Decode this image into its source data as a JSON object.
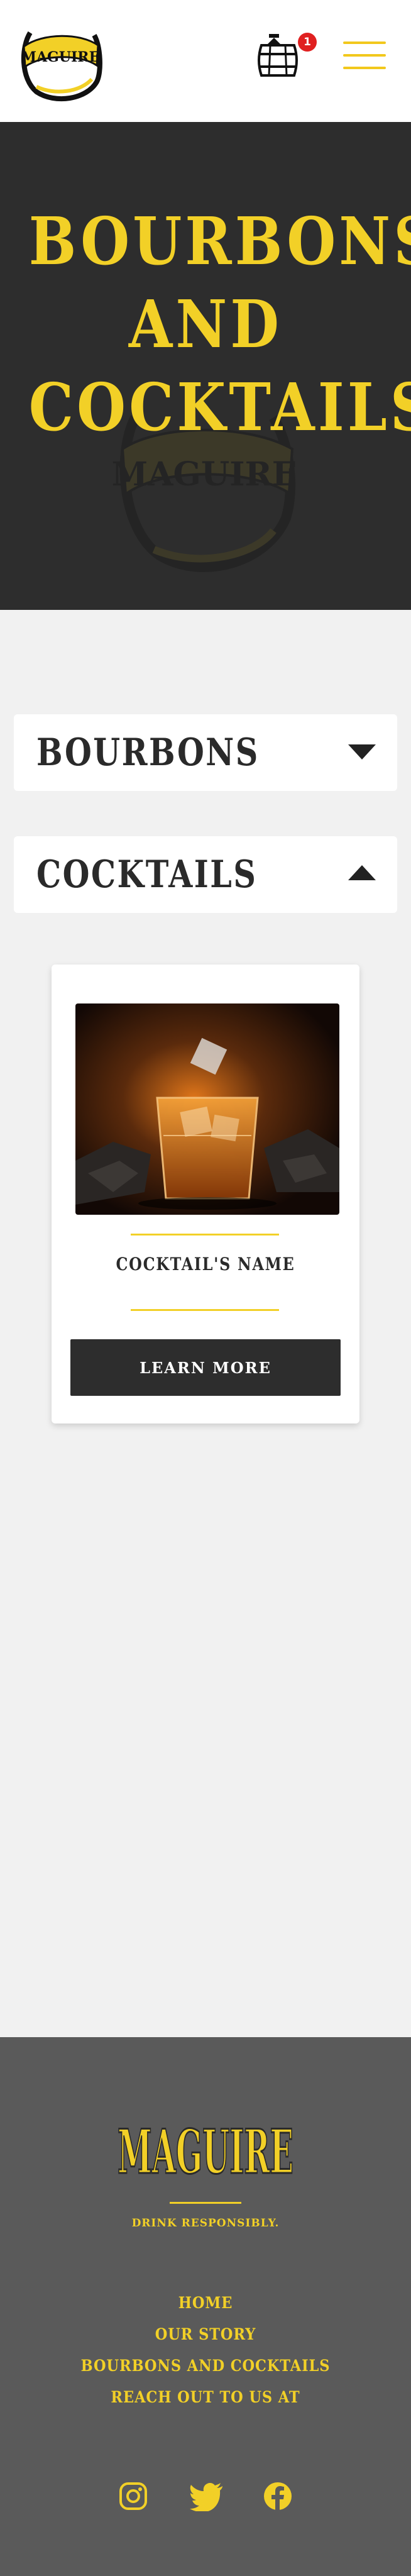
{
  "header": {
    "logo_text": "MAGUIRE",
    "cart_count": "1"
  },
  "hero": {
    "title_line1": "BOURBONS",
    "title_line2": "AND",
    "title_line3": "COCKTAILS",
    "watermark_text": "MAGUIRE"
  },
  "accordion": [
    {
      "label": "BOURBONS",
      "state": "collapsed"
    },
    {
      "label": "COCKTAILS",
      "state": "expanded"
    }
  ],
  "card": {
    "title": "COCKTAIL'S NAME",
    "button_label": "LEARN MORE"
  },
  "footer": {
    "logo_text": "MAGUIRE",
    "tagline": "DRINK RESPONSIBLY.",
    "nav": [
      "HOME",
      "OUR STORY",
      "BOURBONS AND COCKTAILS",
      "REACH OUT TO US AT"
    ],
    "social": [
      "instagram-icon",
      "twitter-icon",
      "facebook-icon"
    ]
  },
  "colors": {
    "accent": "#f2d027",
    "dark": "#2d2d2d",
    "footer_bg": "#5a5a5a",
    "badge": "#e02020"
  }
}
